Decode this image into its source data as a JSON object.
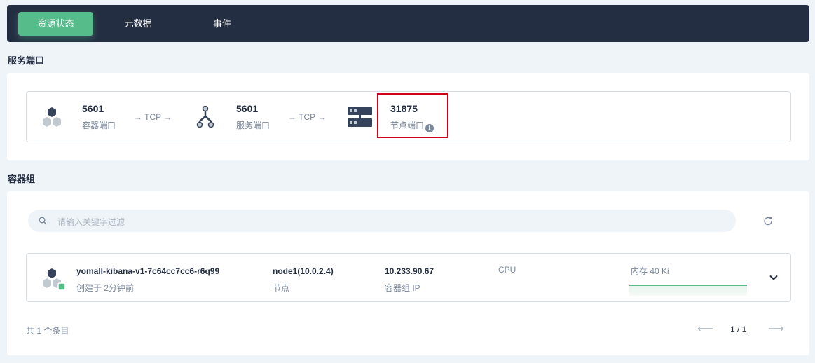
{
  "tabs": [
    {
      "label": "资源状态",
      "active": true
    },
    {
      "label": "元数据",
      "active": false
    },
    {
      "label": "事件",
      "active": false
    }
  ],
  "service_ports": {
    "title": "服务端口",
    "container_port": {
      "value": "5601",
      "label": "容器端口"
    },
    "arrow1": "→ TCP →",
    "service_port": {
      "value": "5601",
      "label": "服务端口"
    },
    "arrow2": "→ TCP →",
    "node_port": {
      "value": "31875",
      "label": "节点端口"
    },
    "icons": {
      "container": "container-cluster-icon",
      "service": "service-topology-icon",
      "node": "server-rack-icon",
      "info": "info-icon"
    }
  },
  "pod_group": {
    "title": "容器组",
    "search_placeholder": "请输入关键字过滤",
    "pod": {
      "name": "yomall-kibana-v1-7c64cc7cc6-r6q99",
      "created": "创建于 2分钟前",
      "node": "node1(10.0.2.4)",
      "node_label": "节点",
      "ip": "10.233.90.67",
      "ip_label": "容器组 IP",
      "cpu_label": "CPU",
      "mem_label": "内存 40 Ki",
      "status_color": "#55bc8a"
    },
    "total": "共 1 个条目",
    "pager": "1 / 1",
    "prev_symbol": "⟵",
    "next_symbol": "⟶"
  },
  "colors": {
    "accent": "#55bc8a",
    "header_bg": "#242e42",
    "highlight": "#d0021b"
  }
}
